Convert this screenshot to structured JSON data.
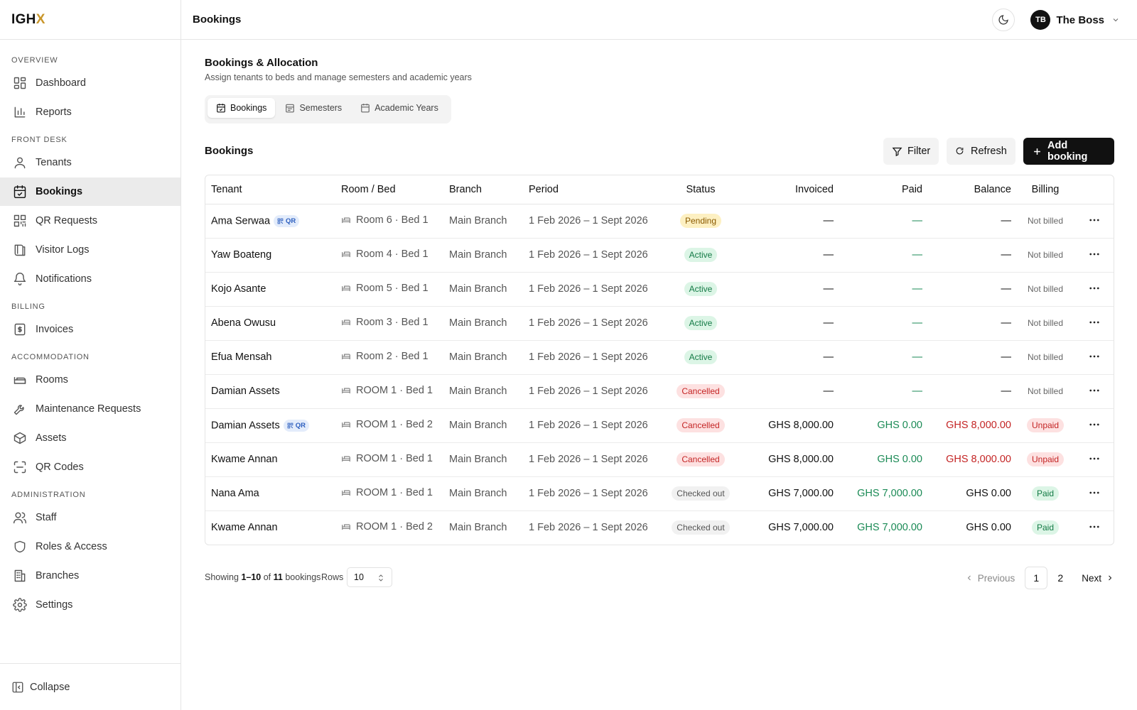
{
  "brand": {
    "logo_main": "IGH",
    "logo_accent": "X"
  },
  "sidebar": {
    "sections": [
      {
        "label": "OVERVIEW",
        "items": [
          {
            "label": "Dashboard",
            "icon": "grid-icon"
          },
          {
            "label": "Reports",
            "icon": "bar-chart-icon"
          }
        ]
      },
      {
        "label": "FRONT DESK",
        "items": [
          {
            "label": "Tenants",
            "icon": "user-icon"
          },
          {
            "label": "Bookings",
            "icon": "calendar-check-icon",
            "active": true
          },
          {
            "label": "QR Requests",
            "icon": "qr-icon"
          },
          {
            "label": "Visitor Logs",
            "icon": "book-icon"
          },
          {
            "label": "Notifications",
            "icon": "bell-icon"
          }
        ]
      },
      {
        "label": "BILLING",
        "items": [
          {
            "label": "Invoices",
            "icon": "dollar-doc-icon"
          }
        ]
      },
      {
        "label": "ACCOMMODATION",
        "items": [
          {
            "label": "Rooms",
            "icon": "bed-icon"
          },
          {
            "label": "Maintenance Requests",
            "icon": "wrench-icon"
          },
          {
            "label": "Assets",
            "icon": "box-icon"
          },
          {
            "label": "QR Codes",
            "icon": "scan-icon"
          }
        ]
      },
      {
        "label": "ADMINISTRATION",
        "items": [
          {
            "label": "Staff",
            "icon": "users-icon"
          },
          {
            "label": "Roles & Access",
            "icon": "shield-icon"
          },
          {
            "label": "Branches",
            "icon": "building-icon"
          },
          {
            "label": "Settings",
            "icon": "gear-icon"
          }
        ]
      }
    ],
    "collapse_label": "Collapse"
  },
  "header": {
    "title": "Bookings",
    "user_initials": "TB",
    "user_name": "The Boss"
  },
  "page": {
    "title": "Bookings & Allocation",
    "subtitle": "Assign tenants to beds and manage semesters and academic years",
    "tabs": [
      {
        "label": "Bookings",
        "active": true
      },
      {
        "label": "Semesters",
        "active": false
      },
      {
        "label": "Academic Years",
        "active": false
      }
    ],
    "section_title": "Bookings",
    "filter_label": "Filter",
    "refresh_label": "Refresh",
    "add_label": "Add booking"
  },
  "table": {
    "headers": [
      "Tenant",
      "Room / Bed",
      "Branch",
      "Period",
      "Status",
      "Invoiced",
      "Paid",
      "Balance",
      "Billing"
    ],
    "rows": [
      {
        "tenant": "Ama Serwaa",
        "qr": true,
        "room": "Room 6 · Bed 1",
        "branch": "Main Branch",
        "period": "1 Feb 2026 – 1 Sept 2026",
        "status": "Pending",
        "invoiced": "—",
        "paid": "—",
        "balance": "—",
        "billing": "Not billed"
      },
      {
        "tenant": "Yaw Boateng",
        "qr": false,
        "room": "Room 4 · Bed 1",
        "branch": "Main Branch",
        "period": "1 Feb 2026 – 1 Sept 2026",
        "status": "Active",
        "invoiced": "—",
        "paid": "—",
        "balance": "—",
        "billing": "Not billed"
      },
      {
        "tenant": "Kojo Asante",
        "qr": false,
        "room": "Room 5 · Bed 1",
        "branch": "Main Branch",
        "period": "1 Feb 2026 – 1 Sept 2026",
        "status": "Active",
        "invoiced": "—",
        "paid": "—",
        "balance": "—",
        "billing": "Not billed"
      },
      {
        "tenant": "Abena Owusu",
        "qr": false,
        "room": "Room 3 · Bed 1",
        "branch": "Main Branch",
        "period": "1 Feb 2026 – 1 Sept 2026",
        "status": "Active",
        "invoiced": "—",
        "paid": "—",
        "balance": "—",
        "billing": "Not billed"
      },
      {
        "tenant": "Efua Mensah",
        "qr": false,
        "room": "Room 2 · Bed 1",
        "branch": "Main Branch",
        "period": "1 Feb 2026 – 1 Sept 2026",
        "status": "Active",
        "invoiced": "—",
        "paid": "—",
        "balance": "—",
        "billing": "Not billed"
      },
      {
        "tenant": "Damian Assets",
        "qr": false,
        "room": "ROOM 1 · Bed 1",
        "branch": "Main Branch",
        "period": "1 Feb 2026 – 1 Sept 2026",
        "status": "Cancelled",
        "invoiced": "—",
        "paid": "—",
        "balance": "—",
        "billing": "Not billed"
      },
      {
        "tenant": "Damian Assets",
        "qr": true,
        "room": "ROOM 1 · Bed 2",
        "branch": "Main Branch",
        "period": "1 Feb 2026 – 1 Sept 2026",
        "status": "Cancelled",
        "invoiced": "GHS 8,000.00",
        "paid": "GHS 0.00",
        "balance": "GHS 8,000.00",
        "balance_tone": "red",
        "billing": "Unpaid"
      },
      {
        "tenant": "Kwame Annan",
        "qr": false,
        "room": "ROOM 1 · Bed 1",
        "branch": "Main Branch",
        "period": "1 Feb 2026 – 1 Sept 2026",
        "status": "Cancelled",
        "invoiced": "GHS 8,000.00",
        "paid": "GHS 0.00",
        "balance": "GHS 8,000.00",
        "balance_tone": "red",
        "billing": "Unpaid"
      },
      {
        "tenant": "Nana Ama",
        "qr": false,
        "room": "ROOM 1 · Bed 1",
        "branch": "Main Branch",
        "period": "1 Feb 2026 – 1 Sept 2026",
        "status": "Checked out",
        "invoiced": "GHS 7,000.00",
        "paid": "GHS 7,000.00",
        "balance": "GHS 0.00",
        "balance_tone": "neutral",
        "billing": "Paid"
      },
      {
        "tenant": "Kwame Annan",
        "qr": false,
        "room": "ROOM 1 · Bed 2",
        "branch": "Main Branch",
        "period": "1 Feb 2026 – 1 Sept 2026",
        "status": "Checked out",
        "invoiced": "GHS 7,000.00",
        "paid": "GHS 7,000.00",
        "balance": "GHS 0.00",
        "balance_tone": "neutral",
        "billing": "Paid"
      }
    ]
  },
  "pagination": {
    "showing_prefix": "Showing",
    "showing_range": "1–10",
    "showing_of": "of",
    "showing_total": "11",
    "showing_suffix": "bookings",
    "rows_label": "Rows",
    "rows_value": "10",
    "prev_label": "Previous",
    "pages": [
      "1",
      "2"
    ],
    "current_page": "1",
    "next_label": "Next"
  },
  "colors": {
    "status": {
      "Pending": {
        "bg": "#fdf0c2",
        "fg": "#8a5a00"
      },
      "Active": {
        "bg": "#dcf5e6",
        "fg": "#137a45"
      },
      "Cancelled": {
        "bg": "#fde1e1",
        "fg": "#c42525"
      },
      "Checked out": {
        "bg": "#f1f1f1",
        "fg": "#555555"
      }
    },
    "billing": {
      "Unpaid": {
        "bg": "#fde1e1",
        "fg": "#c42525"
      },
      "Paid": {
        "bg": "#dcf5e6",
        "fg": "#137a45"
      }
    },
    "paid_green": "#1a8a55",
    "balance_red": "#c42525",
    "primary": "#111111"
  }
}
